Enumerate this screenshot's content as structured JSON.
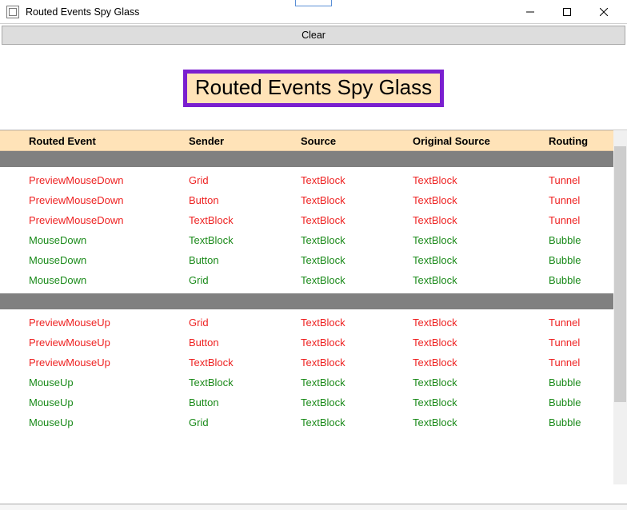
{
  "window": {
    "title": "Routed Events Spy Glass"
  },
  "toolbar": {
    "clear_label": "Clear"
  },
  "banner": {
    "title": "Routed Events Spy Glass"
  },
  "columns": {
    "event": "Routed Event",
    "sender": "Sender",
    "source": "Source",
    "orig": "Original Source",
    "routing": "Routing"
  },
  "groups": [
    {
      "rows": [
        {
          "event": "PreviewMouseDown",
          "sender": "Grid",
          "source": "TextBlock",
          "orig": "TextBlock",
          "routing": "Tunnel",
          "kind": "tunnel"
        },
        {
          "event": "PreviewMouseDown",
          "sender": "Button",
          "source": "TextBlock",
          "orig": "TextBlock",
          "routing": "Tunnel",
          "kind": "tunnel"
        },
        {
          "event": "PreviewMouseDown",
          "sender": "TextBlock",
          "source": "TextBlock",
          "orig": "TextBlock",
          "routing": "Tunnel",
          "kind": "tunnel"
        },
        {
          "event": "MouseDown",
          "sender": "TextBlock",
          "source": "TextBlock",
          "orig": "TextBlock",
          "routing": "Bubble",
          "kind": "bubble"
        },
        {
          "event": "MouseDown",
          "sender": "Button",
          "source": "TextBlock",
          "orig": "TextBlock",
          "routing": "Bubble",
          "kind": "bubble"
        },
        {
          "event": "MouseDown",
          "sender": "Grid",
          "source": "TextBlock",
          "orig": "TextBlock",
          "routing": "Bubble",
          "kind": "bubble"
        }
      ]
    },
    {
      "rows": [
        {
          "event": "PreviewMouseUp",
          "sender": "Grid",
          "source": "TextBlock",
          "orig": "TextBlock",
          "routing": "Tunnel",
          "kind": "tunnel"
        },
        {
          "event": "PreviewMouseUp",
          "sender": "Button",
          "source": "TextBlock",
          "orig": "TextBlock",
          "routing": "Tunnel",
          "kind": "tunnel"
        },
        {
          "event": "PreviewMouseUp",
          "sender": "TextBlock",
          "source": "TextBlock",
          "orig": "TextBlock",
          "routing": "Tunnel",
          "kind": "tunnel"
        },
        {
          "event": "MouseUp",
          "sender": "TextBlock",
          "source": "TextBlock",
          "orig": "TextBlock",
          "routing": "Bubble",
          "kind": "bubble"
        },
        {
          "event": "MouseUp",
          "sender": "Button",
          "source": "TextBlock",
          "orig": "TextBlock",
          "routing": "Bubble",
          "kind": "bubble"
        },
        {
          "event": "MouseUp",
          "sender": "Grid",
          "source": "TextBlock",
          "orig": "TextBlock",
          "routing": "Bubble",
          "kind": "bubble"
        }
      ]
    }
  ]
}
